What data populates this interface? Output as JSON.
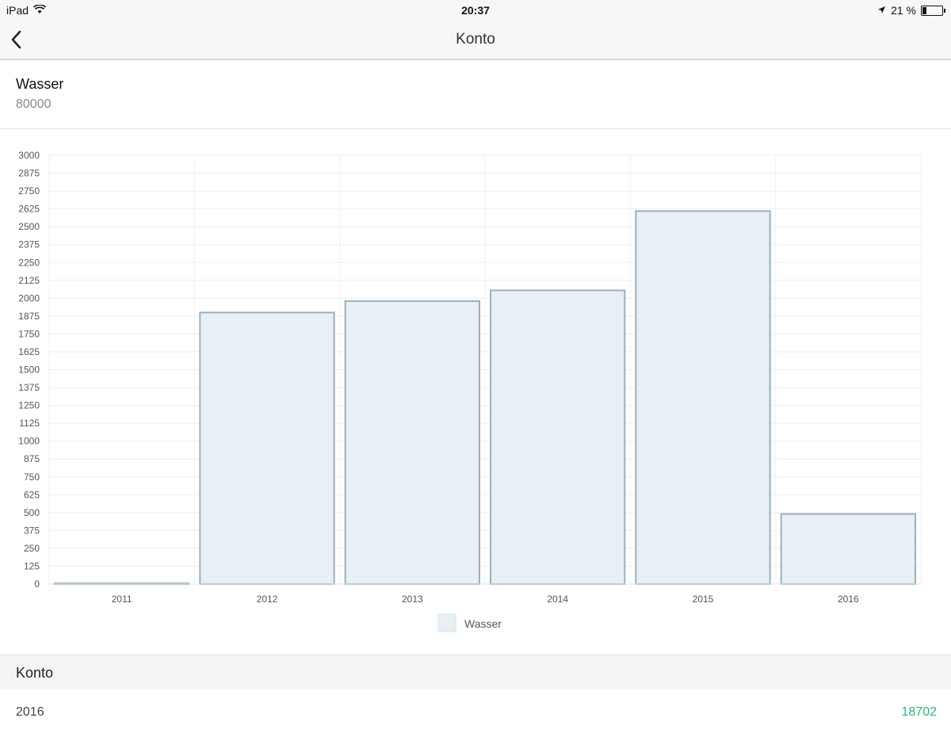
{
  "status_bar": {
    "device": "iPad",
    "time": "20:37",
    "battery_percent": "21 %",
    "icons": [
      "wifi-icon",
      "location-arrow-icon",
      "battery-icon"
    ]
  },
  "nav": {
    "title": "Konto",
    "back_icon": "chevron-left-icon"
  },
  "account": {
    "name": "Wasser",
    "amount": "80000"
  },
  "colors": {
    "bar_fill": "#e8eff5",
    "bar_stroke": "#9ab0be",
    "positive_value": "#2bb673"
  },
  "chart_data": {
    "type": "bar",
    "categories": [
      "2011",
      "2012",
      "2013",
      "2014",
      "2015",
      "2016"
    ],
    "series": [
      {
        "name": "Wasser",
        "values": [
          5,
          1900,
          1980,
          2055,
          2610,
          490
        ]
      }
    ],
    "yticks": [
      "0",
      "125",
      "250",
      "375",
      "500",
      "625",
      "750",
      "875",
      "1000",
      "1125",
      "1250",
      "1375",
      "1500",
      "1625",
      "1750",
      "1875",
      "2000",
      "2125",
      "2250",
      "2375",
      "2500",
      "2625",
      "2750",
      "2875",
      "3000"
    ],
    "ylim": [
      0,
      3000
    ],
    "grid": true,
    "legend": "bottom-center"
  },
  "section": {
    "title": "Konto"
  },
  "list": {
    "items": [
      {
        "year": "2016",
        "value": "18702"
      }
    ]
  }
}
